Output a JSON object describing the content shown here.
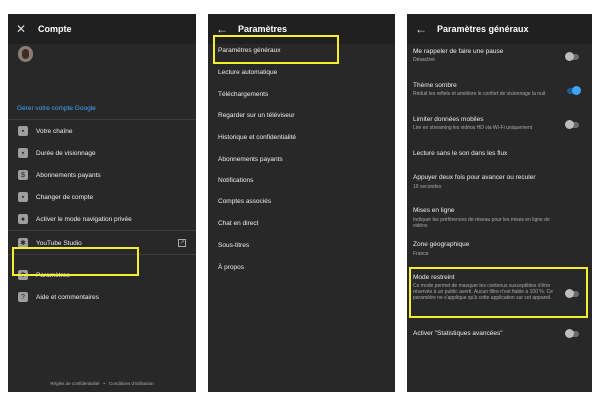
{
  "account": {
    "title": "Compte",
    "close_icon": "✕",
    "manage_link": "Gérer votre compte Google",
    "items": [
      {
        "label": "Votre chaîne",
        "icon": "▪"
      },
      {
        "label": "Durée de visionnage",
        "icon": "▪"
      },
      {
        "label": "Abonnements payants",
        "icon": "$"
      },
      {
        "label": "Changer de compte",
        "icon": "▪"
      },
      {
        "label": "Activer le mode navigation privée",
        "icon": "●"
      },
      {
        "label": "YouTube Studio",
        "icon": "✱"
      },
      {
        "label": "Paramètres",
        "icon": "✱"
      },
      {
        "label": "Aide et commentaires",
        "icon": "?"
      }
    ],
    "footer_privacy": "Règles de confidentialité",
    "footer_dot": "•",
    "footer_terms": "Conditions d'utilisation"
  },
  "settings": {
    "back_icon": "←",
    "title": "Paramètres",
    "items": [
      "Paramètres généraux",
      "Lecture automatique",
      "Téléchargements",
      "Regarder sur un téléviseur",
      "Historique et confidentialité",
      "Abonnements payants",
      "Notifications",
      "Comptes associés",
      "Chat en direct",
      "Sous-titres",
      "À propos"
    ]
  },
  "general": {
    "back_icon": "←",
    "title": "Paramètres généraux",
    "items": [
      {
        "title": "Me rappeler de faire une pause",
        "sub": "Désactivé",
        "toggle": "off"
      },
      {
        "title": "Thème sombre",
        "sub": "Réduit les reflets et améliore le confort de visionnage la nuit",
        "toggle": "on"
      },
      {
        "title": "Limiter données mobiles",
        "sub": "Lire en streaming les vidéos HD via Wi-Fi uniquement",
        "toggle": "off"
      },
      {
        "title": "Lecture sans le son dans les flux",
        "sub": "",
        "toggle": "none"
      },
      {
        "title": "Appuyer deux fois pour avancer ou reculer",
        "sub": "10 secondes",
        "toggle": "none"
      },
      {
        "title": "Mises en ligne",
        "sub": "Indiquer les préférences de réseau pour les mises en ligne de vidéos",
        "toggle": "none"
      },
      {
        "title": "Zone géographique",
        "sub": "France",
        "toggle": "none"
      },
      {
        "title": "Mode restreint",
        "sub": "Ce mode permet de masquer les contenus susceptibles d'être réservés à un public averti. Aucun filtre n'est fiable à 100 %. Ce paramètre ne s'applique qu'à cette application sur cet appareil.",
        "toggle": "off"
      },
      {
        "title": "Activer \"Statistiques avancées\"",
        "sub": "",
        "toggle": "off"
      }
    ]
  },
  "colors": {
    "highlight": "#f6ee2a",
    "link": "#3ea6ff",
    "panel": "#282828",
    "toggle_on": "#3ea6ff"
  }
}
